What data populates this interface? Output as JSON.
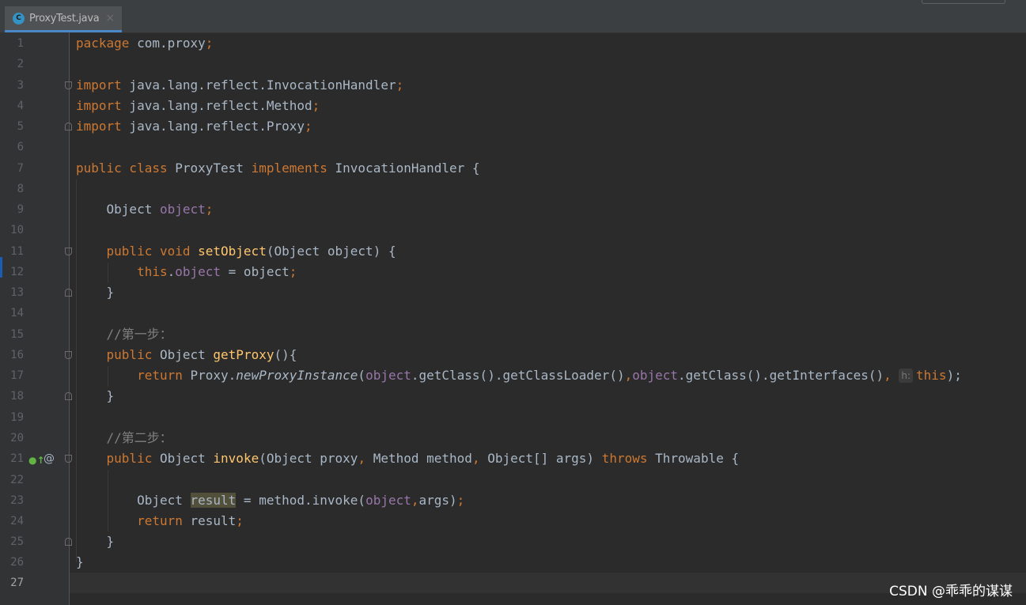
{
  "tab": {
    "icon_letter": "C",
    "filename": "ProxyTest.java",
    "close_glyph": "×"
  },
  "gutter_icons": {
    "implements_marker": "●↑",
    "annotation_marker": "@"
  },
  "param_hint": "h:",
  "watermark": "CSDN @乖乖的谋谋",
  "line_numbers": [
    "1",
    "2",
    "3",
    "4",
    "5",
    "6",
    "7",
    "8",
    "9",
    "10",
    "11",
    "12",
    "13",
    "14",
    "15",
    "16",
    "17",
    "18",
    "19",
    "20",
    "21",
    "22",
    "23",
    "24",
    "25",
    "26",
    "27"
  ],
  "code": {
    "l1": [
      "package",
      " com.proxy",
      ";"
    ],
    "l3": [
      "import",
      " java.lang.reflect.InvocationHandler",
      ";"
    ],
    "l4": [
      "import",
      " java.lang.reflect.Method",
      ";"
    ],
    "l5": [
      "import",
      " java.lang.reflect.Proxy",
      ";"
    ],
    "l7": [
      "public class",
      " ProxyTest ",
      "implements",
      " InvocationHandler {"
    ],
    "l9": [
      "    Object ",
      "object",
      ";"
    ],
    "l11": [
      "    public void ",
      "setObject",
      "(Object object) {"
    ],
    "l12": [
      "        ",
      "this",
      ".",
      "object",
      " = object",
      ";"
    ],
    "l13": [
      "    }"
    ],
    "l15": [
      "    //第一步："
    ],
    "l16": [
      "    public ",
      "Object ",
      "getProxy",
      "(){"
    ],
    "l17": [
      "        ",
      "return ",
      "Proxy.",
      "newProxyInstance",
      "(",
      "object",
      ".getClass().getClassLoader()",
      ",",
      "object",
      ".getClass().getInterfaces()",
      ", ",
      "this",
      ");"
    ],
    "l18": [
      "    }"
    ],
    "l20": [
      "    //第二步："
    ],
    "l21": [
      "    public ",
      "Object ",
      "invoke",
      "(Object proxy",
      ", ",
      "Method method",
      ", ",
      "Object[] args) ",
      "throws ",
      "Throwable {"
    ],
    "l23": [
      "        Object ",
      "result",
      " = method.invoke(",
      "object",
      ",",
      "args)",
      ";"
    ],
    "l24": [
      "        ",
      "return ",
      "result",
      ";"
    ],
    "l25": [
      "    }"
    ],
    "l26": [
      "}"
    ]
  },
  "colors": {
    "keyword": "#cc7832",
    "method_decl": "#ffc66d",
    "field": "#9876aa",
    "text": "#a9b7c6",
    "comment": "#808080",
    "background": "#2b2b2b",
    "gutter": "#313335"
  }
}
